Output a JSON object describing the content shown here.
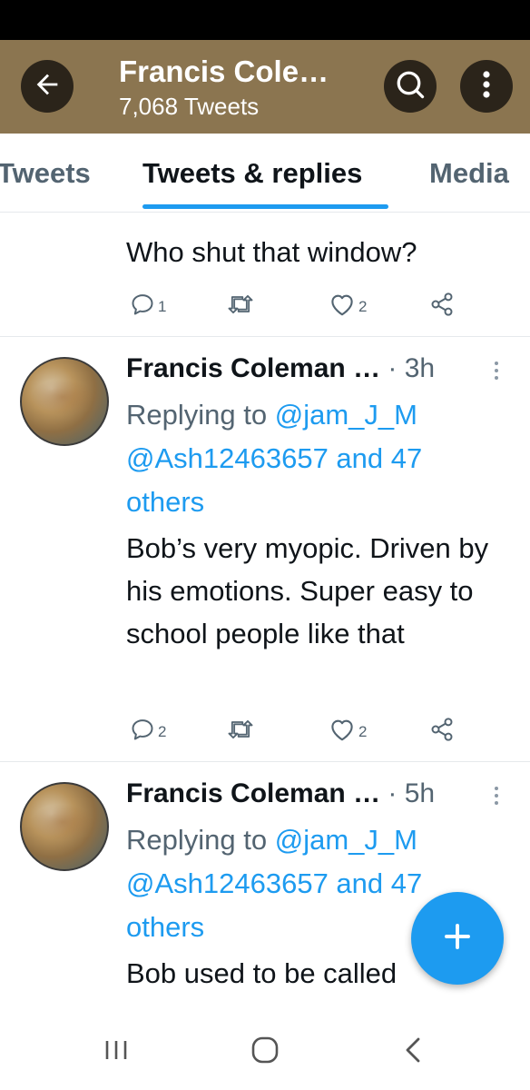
{
  "header": {
    "title": "Francis Cole…",
    "subtitle": "7,068 Tweets"
  },
  "tabs": [
    {
      "label": "Tweets",
      "active": false
    },
    {
      "label": "Tweets & replies",
      "active": true
    },
    {
      "label": "Media",
      "active": false
    }
  ],
  "tweets": [
    {
      "text": "Who shut that window?",
      "replies": "1",
      "retweets": "",
      "likes": "2"
    },
    {
      "author": "Francis Coleman …",
      "time": "· 3h",
      "replying_prefix": "Replying to ",
      "mention_1": "@jam_J_M",
      "mention_2": "@Ash12463657",
      "and_text": " and 47",
      "others": "others",
      "text": "Bob’s very myopic. Driven by his emotions. Super easy to school people like that",
      "replies": "2",
      "retweets": "",
      "likes": "2"
    },
    {
      "author": "Francis Coleman …",
      "time": "· 5h",
      "replying_prefix": "Replying to ",
      "mention_1": "@jam_J_M",
      "mention_2": "@Ash12463657",
      "and_text": " and 47",
      "others": "others",
      "text": "Bob used to be called"
    }
  ],
  "icons": {
    "back": "arrow-left-icon",
    "search": "search-icon",
    "more": "more-vertical-icon",
    "reply": "reply-icon",
    "retweet": "retweet-icon",
    "like": "heart-icon",
    "share": "share-icon",
    "compose": "plus-icon",
    "nav_recent": "recent-apps-icon",
    "nav_home": "home-icon",
    "nav_back": "back-chevron-icon"
  },
  "colors": {
    "header_bg": "#8b7550",
    "accent": "#1d9bf0",
    "text_primary": "#0f1419",
    "text_secondary": "#536471"
  }
}
